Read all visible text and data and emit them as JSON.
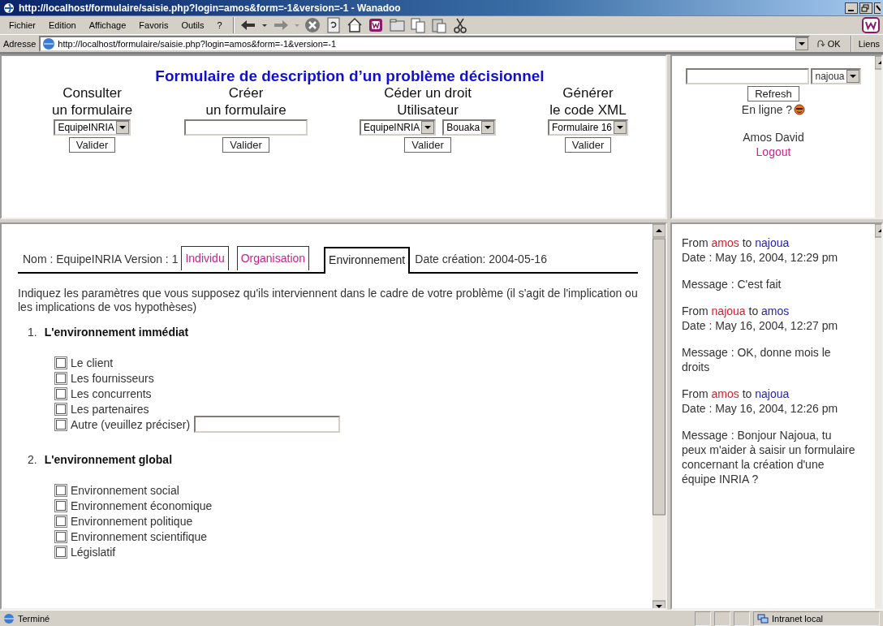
{
  "window": {
    "title": "http://localhost/formulaire/saisie.php?login=amos&form=-1&version=-1 - Wanadoo"
  },
  "menu": [
    "Fichier",
    "Edition",
    "Affichage",
    "Favoris",
    "Outils",
    "?"
  ],
  "address_bar": {
    "label": "Adresse",
    "url": "http://localhost/formulaire/saisie.php?login=amos&form=-1&version=-1",
    "go": "OK",
    "links": "Liens"
  },
  "header": {
    "title": "Formulaire de description d’un problème décisionnel",
    "sections": [
      {
        "heading": [
          "Consulter",
          "un formulaire"
        ],
        "controls": [
          {
            "kind": "select",
            "value": "EquipeINRIA"
          }
        ],
        "button": "Valider"
      },
      {
        "heading": [
          "Créer",
          "un formulaire"
        ],
        "controls": [
          {
            "kind": "input"
          }
        ],
        "button": "Valider"
      },
      {
        "heading": [
          "Céder un droit",
          "Utilisateur"
        ],
        "controls": [
          {
            "kind": "select",
            "value": "EquipeINRIA"
          },
          {
            "kind": "select",
            "value": "Bouaka"
          }
        ],
        "button": "Valider"
      },
      {
        "heading": [
          "Générer",
          "le code XML"
        ],
        "controls": [
          {
            "kind": "select",
            "value": "Formulaire 16"
          }
        ],
        "button": "Valider"
      }
    ]
  },
  "user_panel": {
    "user_select": "najoua",
    "refresh": "Refresh",
    "online": "En ligne ?",
    "name": "Amos David",
    "logout": "Logout"
  },
  "form": {
    "info": "Nom : EquipeINRIA Version : 1",
    "tabs": [
      {
        "label": "Individu",
        "selected": false
      },
      {
        "label": "Organisation",
        "selected": false
      },
      {
        "label": "Environnement",
        "selected": true
      }
    ],
    "date": "Date création: 2004-05-16",
    "intro": "Indiquez les paramètres que vous supposez qu'ils interviennent dans le cadre de votre problème (il s'agit de l'implication ou les implications de vos hypothèses)",
    "sections": [
      {
        "number": "1.",
        "title": "L'environnement immédiat",
        "items": [
          {
            "kind": "checkbox",
            "label": "Le client",
            "checked": false
          },
          {
            "kind": "checkbox",
            "label": "Les fournisseurs",
            "checked": false
          },
          {
            "kind": "checkbox",
            "label": "Les concurrents",
            "checked": false
          },
          {
            "kind": "checkbox",
            "label": "Les partenaires",
            "checked": false
          },
          {
            "kind": "other",
            "label": "Autre (veuillez préciser)",
            "checked": false
          }
        ]
      },
      {
        "number": "2.",
        "title": "L'environnement global",
        "items": [
          {
            "kind": "checkbox",
            "label": "Environnement social",
            "checked": false
          },
          {
            "kind": "checkbox",
            "label": "Environnement économique",
            "checked": false
          },
          {
            "kind": "checkbox",
            "label": "Environnement politique",
            "checked": false
          },
          {
            "kind": "checkbox",
            "label": "Environnement scientifique",
            "checked": false
          },
          {
            "kind": "checkbox",
            "label": "Législatif",
            "checked": false
          }
        ]
      }
    ]
  },
  "chat": [
    {
      "from_word": "From",
      "from": "amos",
      "to_word": "to",
      "to": "najoua",
      "date": "Date : May 16, 2004, 12:29 pm",
      "message": "Message : C'est fait"
    },
    {
      "from_word": "From",
      "from": "najoua",
      "to_word": "to",
      "to": "amos",
      "date": "Date : May 16, 2004, 12:27 pm",
      "message": "Message : OK, donne mois le droits"
    },
    {
      "from_word": "From",
      "from": "amos",
      "to_word": "to",
      "to": "najoua",
      "date": "Date : May 16, 2004, 12:26 pm",
      "message": "Message : Bonjour Najoua, tu peux m'aider à saisir un formulaire concernant la création d'une équipe INRIA ?"
    }
  ],
  "status_bar": {
    "text": "Terminé",
    "zone": "Intranet local"
  }
}
